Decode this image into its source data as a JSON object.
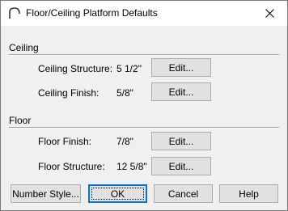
{
  "window": {
    "title": "Floor/Ceiling Platform Defaults",
    "app_icon": "arc-icon",
    "close_glyph": "✕"
  },
  "ceiling": {
    "section_label": "Ceiling",
    "rows": [
      {
        "label": "Ceiling Structure:",
        "value": "5 1/2\"",
        "button": "Edit..."
      },
      {
        "label": "Ceiling Finish:",
        "value": "5/8\"",
        "button": "Edit..."
      }
    ]
  },
  "floor": {
    "section_label": "Floor",
    "rows": [
      {
        "label": "Floor Finish:",
        "value": "7/8\"",
        "button": "Edit..."
      },
      {
        "label": "Floor Structure:",
        "value": "12 5/8\"",
        "button": "Edit..."
      }
    ]
  },
  "footer": {
    "number_style_label": "Number Style...",
    "ok_label": "OK",
    "cancel_label": "Cancel",
    "help_label": "Help"
  },
  "colors": {
    "dialog_background": "#f0f0f0",
    "titlebar_background": "#ffffff",
    "button_face": "#e1e1e1",
    "default_button_border": "#0078d7"
  }
}
